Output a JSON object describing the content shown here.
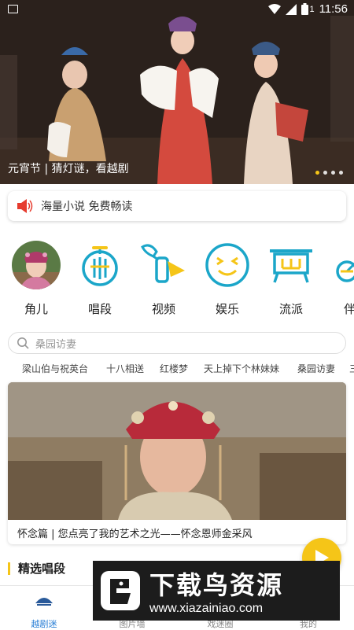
{
  "status_bar": {
    "time": "11:56",
    "battery": "1"
  },
  "banner": {
    "caption": "元宵节 | 猜灯谜，看越剧",
    "dot_count": 4,
    "active_dot": 0
  },
  "notice": {
    "text": "海量小说 免费畅读",
    "icon": "speaker-icon"
  },
  "categories": [
    {
      "label": "角儿",
      "icon": "avatar-photo"
    },
    {
      "label": "唱段",
      "icon": "singing-icon"
    },
    {
      "label": "视频",
      "icon": "video-icon"
    },
    {
      "label": "娱乐",
      "icon": "smiley-icon"
    },
    {
      "label": "流派",
      "icon": "school-icon"
    },
    {
      "label": "伴",
      "icon": "accompany-icon"
    }
  ],
  "search": {
    "placeholder": "桑园访妻"
  },
  "hot_tags": [
    "梁山伯与祝英台",
    "十八相送",
    "红楼梦",
    "天上掉下个林妹妹",
    "桑园访妻",
    "三"
  ],
  "feature_card": {
    "title": "怀念篇 | 您点亮了我的艺术之光——怀念恩师金采风"
  },
  "section": {
    "title": "精选唱段"
  },
  "bottom_nav": [
    {
      "label": "越剧迷",
      "icon": "home-icon",
      "active": true
    },
    {
      "label": "图片墙",
      "icon": "gallery-icon",
      "active": false
    },
    {
      "label": "戏迷圈",
      "icon": "circle-icon",
      "active": false
    },
    {
      "label": "我的",
      "icon": "profile-icon",
      "active": false
    }
  ],
  "watermark": {
    "title": "下载鸟资源",
    "url": "www.xiazainiao.com"
  },
  "colors": {
    "accent": "#f5c518",
    "icon_blue": "#1ba6c9",
    "icon_yellow": "#f5c518",
    "nav_active": "#2a7fd6",
    "notice_red": "#e63b2e"
  }
}
